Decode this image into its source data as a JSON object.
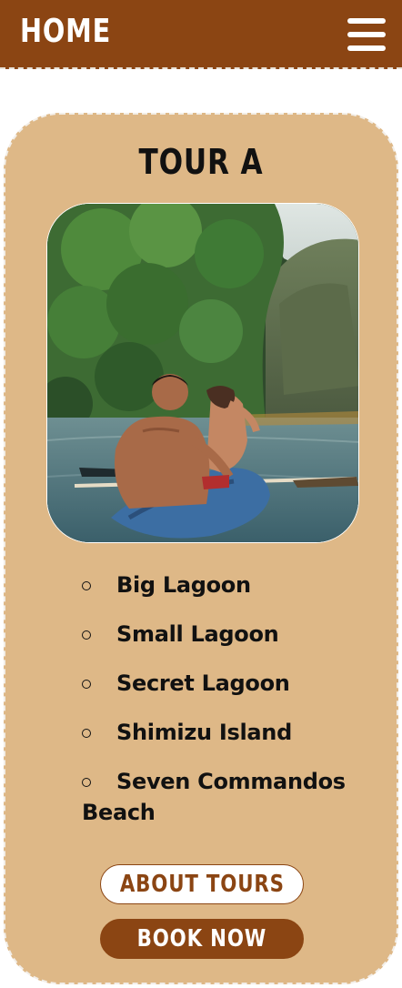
{
  "header": {
    "title": "HOME",
    "menu_icon": "hamburger-menu-icon",
    "background_color": "#8b4513"
  },
  "card": {
    "title": "TOUR A",
    "background_color": "#deb887",
    "photo_description_icon": "kayak-photo",
    "stops": [
      "Big Lagoon",
      "Small Lagoon",
      "Secret Lagoon",
      "Shimizu Island",
      "Seven Commandos Beach"
    ],
    "buttons": {
      "about_label": "ABOUT TOURS",
      "book_label": "BOOK NOW"
    }
  }
}
